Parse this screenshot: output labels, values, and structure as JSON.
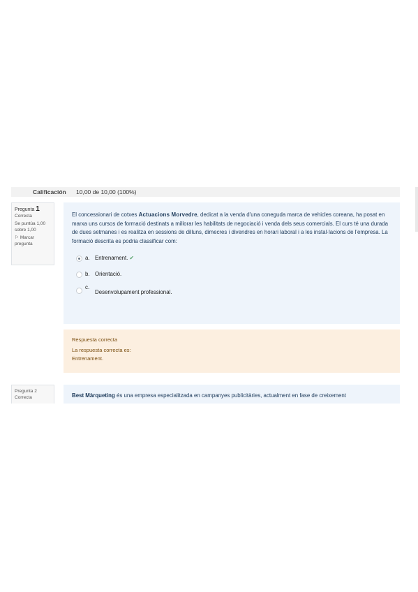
{
  "grade": {
    "label": "Calificación",
    "value": "10,00 de 10,00 (100%)"
  },
  "question1": {
    "title": "Pregunta",
    "number": "1",
    "state": "Correcta",
    "score": "Se puntúa 1,00 sobre 1,00",
    "flag": "Marcar pregunta",
    "text_before": "El concessionari de cotxes ",
    "company": "Actuacions Morvedre",
    "text_after": ", dedicat a la venda d'una coneguda marca de vehicles coreana, ha posat en marxa uns cursos de formació destinats a millorar les habilitats de negociació i venda dels seus comercials. El curs té una durada de dues setmanes i es realitza en sessions de dilluns, dimecres i divendres en horari laboral i a les instal·lacions de l'empresa. La formació descrita es podria classificar com:",
    "answers": [
      {
        "letter": "a.",
        "text": "Entrenament.",
        "selected": true
      },
      {
        "letter": "b.",
        "text": "Orientació.",
        "selected": false
      },
      {
        "letter": "c.",
        "text": "Desenvolupament professional.",
        "selected": false
      }
    ],
    "feedback_title": "Respuesta correcta",
    "feedback_label": "La respuesta correcta es:",
    "feedback_answer": "Entrenament."
  },
  "question2": {
    "title": "Pregunta",
    "number": "2",
    "state": "Correcta",
    "company": "Best Màrqueting",
    "text_after": " és una empresa especialitzada en campanyes publicitàries, actualment en fase de creixement"
  }
}
